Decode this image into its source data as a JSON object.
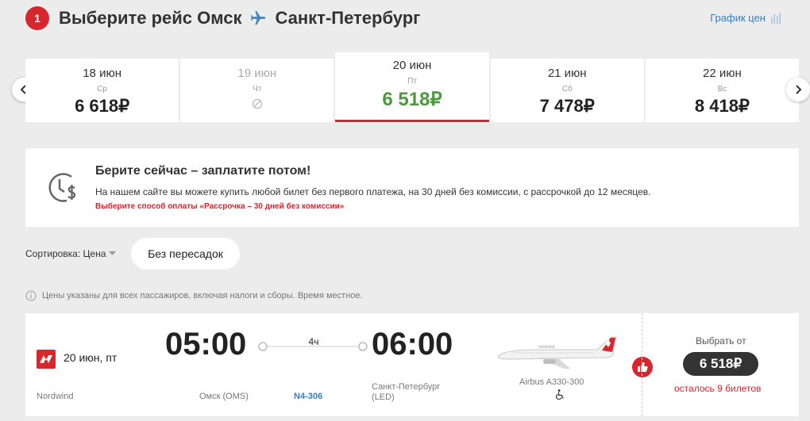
{
  "header": {
    "step": "1",
    "title_prefix": "Выберите рейс Омск",
    "title_destination": "Санкт-Петербург",
    "price_chart_label": "График цен"
  },
  "dates": [
    {
      "date": "18 июн",
      "weekday": "Ср",
      "price": "6 618₽",
      "state": "normal"
    },
    {
      "date": "19 июн",
      "weekday": "Чт",
      "price": "",
      "state": "disabled"
    },
    {
      "date": "20 июн",
      "weekday": "Пт",
      "price": "6 518₽",
      "state": "selected"
    },
    {
      "date": "21 июн",
      "weekday": "Сб",
      "price": "7 478₽",
      "state": "normal"
    },
    {
      "date": "22 июн",
      "weekday": "Вс",
      "price": "8 418₽",
      "state": "normal"
    }
  ],
  "promo": {
    "title": "Берите сейчас – заплатите потом!",
    "text": "На нашем сайте вы можете купить любой билет без первого платежа, на 30 дней без комиссии, с рассрочкой до 12 месяцев.",
    "link": "Выберите способ оплаты «Рассрочка – 30 дней без комиссии»"
  },
  "filters": {
    "sort_label": "Сортировка: Цена",
    "direct_label": "Без пересадок"
  },
  "note": "Цены указаны для всех пассажиров, включая налоги и сборы. Время местное.",
  "flight": {
    "date": "20 июн, пт",
    "airline": "Nordwind",
    "departure_time": "05:00",
    "departure_airport": "Омск (OMS)",
    "duration": "4ч",
    "flight_number": "N4-306",
    "arrival_time": "06:00",
    "arrival_city": "Санкт-Петербург",
    "arrival_code": "(LED)",
    "aircraft": "Airbus A330-300",
    "choose_label": "Выбрать от",
    "price": "6 518₽",
    "seats_left": "осталось 9 билетов"
  },
  "colors": {
    "accent": "#d8262e",
    "selected_price": "#4b9a3d",
    "link": "#3a7bbf",
    "background": "#ececec"
  }
}
